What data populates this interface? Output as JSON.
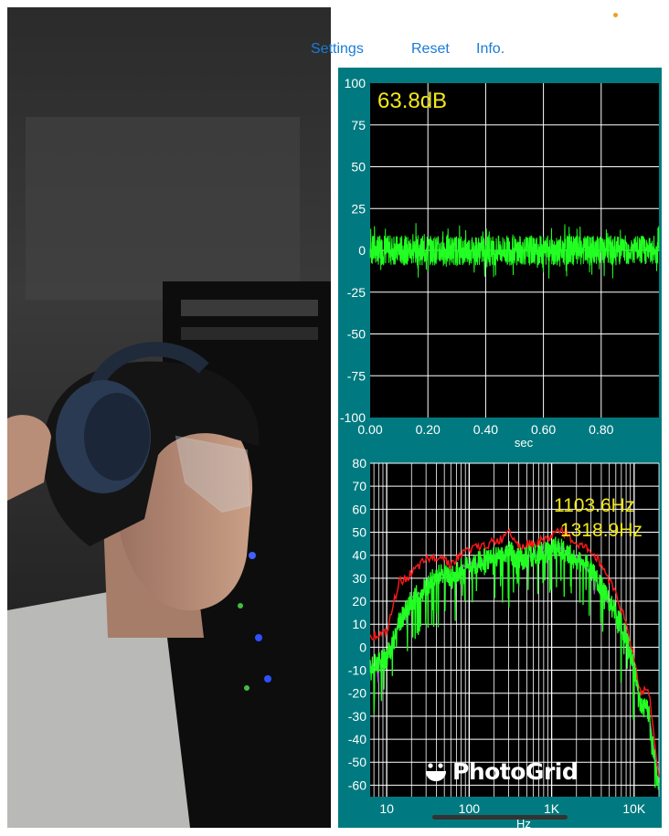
{
  "nav": {
    "settings_label": "Settings",
    "reset_label": "Reset",
    "info_label": "Info."
  },
  "scope": {
    "level_readout": "63.8dB",
    "y_ticks": [
      "100",
      "75",
      "50",
      "25",
      "0",
      "-25",
      "-50",
      "-75",
      "-100"
    ],
    "x_ticks": [
      "0.00",
      "0.20",
      "0.40",
      "0.60",
      "0.80"
    ],
    "x_axis_label": "sec",
    "trace_color": "#22ff22"
  },
  "spectrum": {
    "peak_labels": [
      "1103.6Hz",
      "1318.9Hz"
    ],
    "y_ticks": [
      "80",
      "70",
      "60",
      "50",
      "40",
      "30",
      "20",
      "10",
      "0",
      "-10",
      "-20",
      "-30",
      "-40",
      "-50",
      "-60"
    ],
    "x_ticks": [
      "10",
      "100",
      "1K",
      "10K"
    ],
    "x_axis_label": "Hz",
    "series_colors": {
      "max_hold": "#ff1a1a",
      "average": "#a040d0",
      "live": "#22ff22"
    }
  },
  "watermark": {
    "text": "PhotoGrid"
  },
  "colors": {
    "panel": "#007a80",
    "plot_bg": "#000000",
    "grid": "#ffffff",
    "readout": "#f2e81a",
    "nav_link": "#1b7bd6"
  }
}
